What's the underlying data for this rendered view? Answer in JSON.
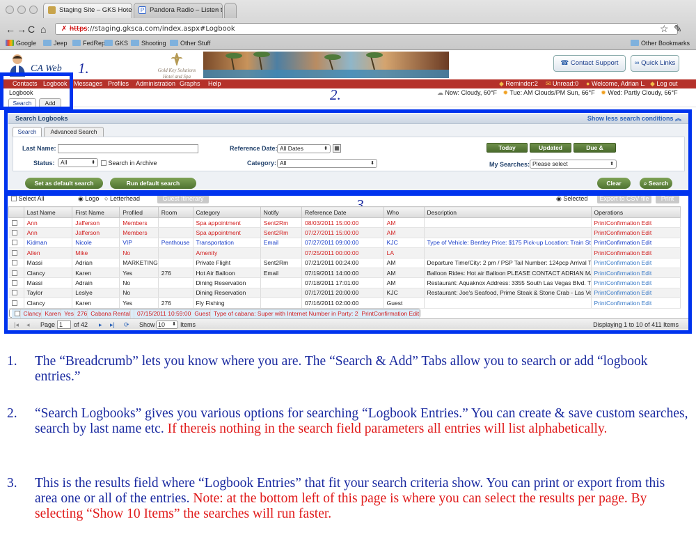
{
  "browser": {
    "tabs": [
      {
        "label": "Staging Site – GKS Hotel | Lo",
        "favicon": "gks-icon"
      },
      {
        "label": "Pandora Radio – Listen to Fr",
        "favicon": "pandora-icon"
      }
    ],
    "url_scheme": "https",
    "url_rest": "://staging.gksca.com/index.aspx#Logbook",
    "bookmarks": [
      "Google",
      "Jeep",
      "FedRep",
      "GKS",
      "Shooting",
      "Other Stuff"
    ],
    "other_bookmarks": "Other Bookmarks"
  },
  "header": {
    "logo": "CA Web",
    "hotel_logo": "Gold Key Solutions Hotel and Spa",
    "contact_support": "Contact Support",
    "quick_links": "Quick Links"
  },
  "annotations": {
    "one": "1.",
    "two": "2.",
    "three": "3."
  },
  "menu": {
    "items": [
      "Contacts",
      "Logbook",
      "Messages",
      "Profiles",
      "Administration",
      "Graphs",
      "Help"
    ],
    "reminder": "Reminder:2",
    "unread": "Unread:0",
    "welcome": "Welcome, Adrian L.",
    "logout": "Log out"
  },
  "breadcrumb": "Logbook",
  "subtabs": [
    "Search",
    "Add"
  ],
  "weather": {
    "now": "Now: Cloudy, 60°F",
    "tue": "Tue: AM Clouds/PM Sun, 66°F",
    "wed": "Wed: Partly Cloudy, 66°F"
  },
  "search": {
    "title": "Search Logbooks",
    "toggle": "Show less search conditions",
    "tabs": [
      "Search",
      "Advanced Search"
    ],
    "last_name_label": "Last Name:",
    "last_name_value": "",
    "status_label": "Status:",
    "status_value": "All",
    "archive_label": "Search in Archive",
    "ref_date_label": "Reference Date:",
    "ref_date_value": "All Dates",
    "category_label": "Category:",
    "category_value": "All",
    "quick_buttons": [
      "Today",
      "Updated Today",
      "Due & Overdue"
    ],
    "my_searches_label": "My Searches:",
    "my_searches_value": "Please select",
    "set_default": "Set as default search",
    "run_default": "Run default search",
    "clear": "Clear",
    "search": "Search"
  },
  "results": {
    "select_all": "Select All",
    "logo": "Logo",
    "letterhead": "Letterhead",
    "guest_itinerary": "Guest Itinerary",
    "selected": "Selected",
    "export_csv": "Export to CSV file",
    "print": "Print",
    "columns": [
      "Last Name",
      "First Name",
      "Profiled",
      "Room",
      "Category",
      "Notify",
      "Reference Date",
      "Who",
      "Description",
      "Operations"
    ],
    "rows": [
      {
        "color": "red",
        "cells": [
          "Ann",
          "Jafferson",
          "Members",
          "",
          "Spa appointment",
          "Sent2Rm",
          "08/03/2011 15:00:00",
          "AM",
          "",
          "PrintConfirmation  Edit"
        ]
      },
      {
        "color": "red",
        "cells": [
          "Ann",
          "Jafferson",
          "Members",
          "",
          "Spa appointment",
          "Sent2Rm",
          "07/27/2011 15:00:00",
          "AM",
          "",
          "PrintConfirmation  Edit"
        ]
      },
      {
        "color": "blue",
        "cells": [
          "Kidman",
          "Nicole",
          "VIP",
          "Penthouse",
          "Transportation",
          "Email",
          "07/27/2011 09:00:00",
          "KJC",
          "Type of Vehicle: Bentley Price: $175 Pick-up Location: Train Sta...",
          "PrintConfirmation  Edit"
        ]
      },
      {
        "color": "red",
        "cells": [
          "Allen",
          "Mike",
          "No",
          "",
          "Amenity",
          "",
          "07/25/2011 00:00:00",
          "LA",
          "",
          "PrintConfirmation  Edit"
        ]
      },
      {
        "color": "black",
        "cells": [
          "Massi",
          "Adrian",
          "MARKETING",
          "",
          "Private Flight",
          "Sent2Rm",
          "07/21/2011 00:24:00",
          "AM",
          "Departure Time/City: 2 pm / PSP Tail Number: 124pcp Arrival Ti...",
          "PrintConfirmation  Edit"
        ]
      },
      {
        "color": "black",
        "cells": [
          "Clancy",
          "Karen",
          "Yes",
          "276",
          "Hot Air Balloon",
          "Email",
          "07/19/2011 14:00:00",
          "AM",
          "Balloon Rides: Hot air Balloon PLEASE CONTACT ADRIAN MA...",
          "PrintConfirmation  Edit"
        ]
      },
      {
        "color": "black",
        "cells": [
          "Massi",
          "Adrain",
          "No",
          "",
          "Dining Reservation",
          "",
          "07/18/2011 17:01:00",
          "AM",
          "Restaurant: Aquaknox Address: 3355 South Las Vegas Blvd. T...",
          "PrintConfirmation  Edit"
        ]
      },
      {
        "color": "black",
        "cells": [
          "Taylor",
          "Leslye",
          "No",
          "",
          "Dining Reservation",
          "",
          "07/17/2011 20:00:00",
          "KJC",
          "Restaurant: Joe's Seafood, Prime Steak & Stone Crab - Las Ve...",
          "PrintConfirmation  Edit"
        ]
      },
      {
        "color": "black",
        "cells": [
          "Clancy",
          "Karen",
          "Yes",
          "276",
          "Fly Fishing",
          "",
          "07/16/2011 02:00:00",
          "Guest",
          "",
          "PrintConfirmation  Edit"
        ]
      },
      {
        "color": "red",
        "cells": [
          "Clancy",
          "Karen",
          "Yes",
          "276",
          "Cabana Rental",
          "",
          "07/15/2011 10:59:00",
          "Guest",
          "Type of cabana: Super with Internet Number in Party: 2",
          "PrintConfirmation  Edit"
        ]
      }
    ],
    "pager": {
      "page_label": "Page",
      "page_value": "1",
      "of_pages": "of 42",
      "show_label": "Show",
      "show_value": "10",
      "items_label": "Items",
      "displaying": "Displaying 1 to 10 of 411 Items"
    }
  },
  "notes": [
    {
      "num": "1.",
      "text": "The “Breadcrumb” lets you know where you are.  The “Search & Add” Tabs allow you to search or add “logbook entries.”",
      "red": ""
    },
    {
      "num": "2.",
      "text": "“Search Logbooks” gives you various options for searching “Logbook Entries.”  You can create & save custom searches, search by last name etc. ",
      "red": " If thereis nothing in the search field parameters all entries will list alphabetically."
    },
    {
      "num": "3.",
      "text": "This is the results field where “Logbook Entries” that fit your search criteria show.  You can print or export from this area one or all of the entries. ",
      "red": " Note: at the bottom left of this page is where you can select the results per page.  By selecting “Show 10 Items” the searches will run faster."
    }
  ],
  "colors": {
    "menu_red": "#b5312a",
    "annotation_blue": "#0033ee",
    "button_green": "#5a7d38"
  }
}
